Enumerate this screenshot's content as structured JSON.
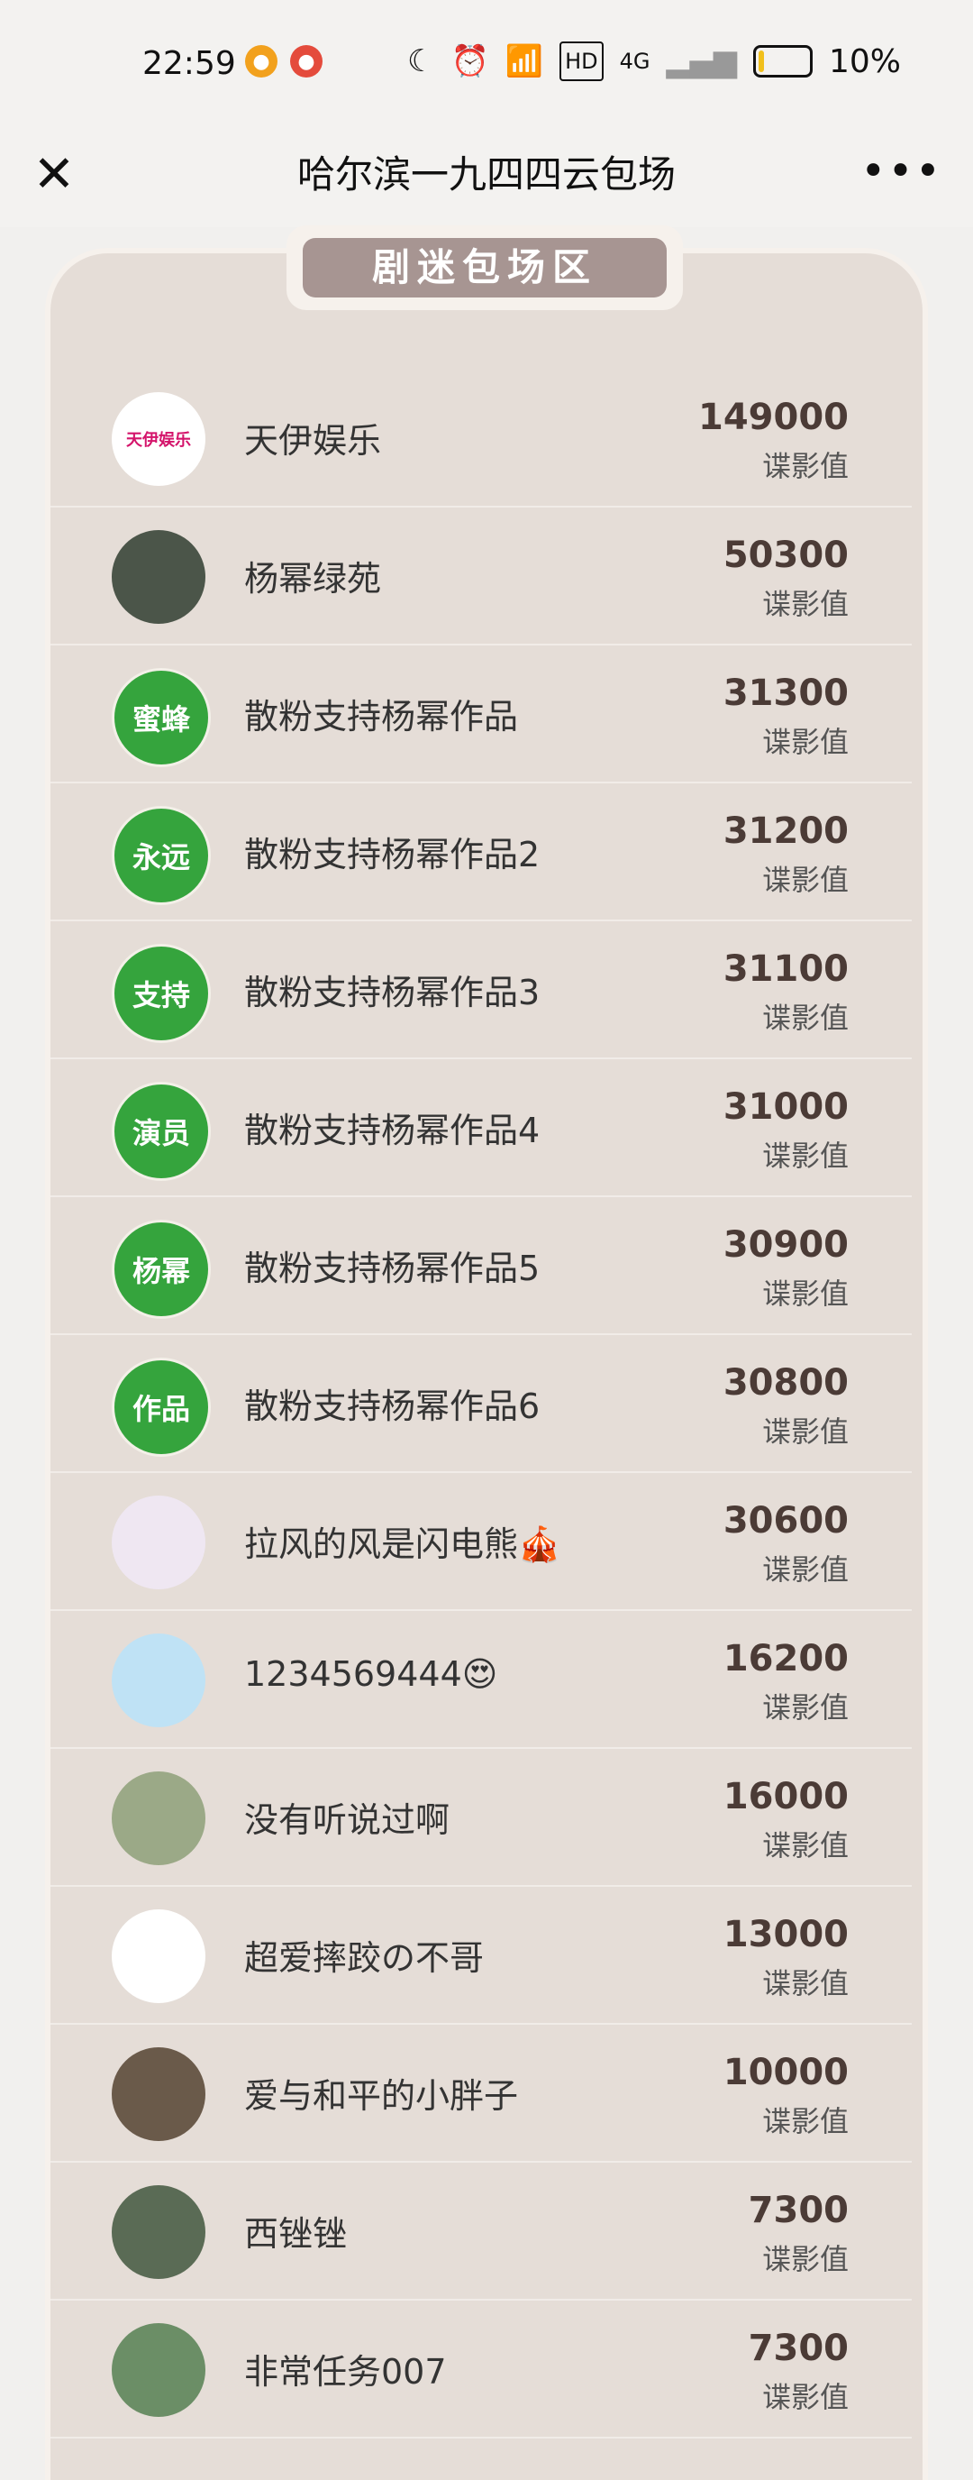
{
  "status": {
    "time": "22:59",
    "battery": "10%",
    "network": "4G",
    "hd": "HD"
  },
  "nav": {
    "title": "哈尔滨一九四四云包场",
    "close_label": "✕",
    "more_label": "•••"
  },
  "section_badge": "剧迷包场区",
  "items": [
    {
      "name": "天伊娱乐",
      "value": "149000",
      "unit": "谍影值",
      "avatar_text": "天伊娱乐"
    },
    {
      "name": "杨幂绿苑",
      "value": "50300",
      "unit": "谍影值",
      "avatar_text": ""
    },
    {
      "name": "散粉支持杨幂作品",
      "value": "31300",
      "unit": "谍影值",
      "avatar_text": "蜜蜂"
    },
    {
      "name": "散粉支持杨幂作品2",
      "value": "31200",
      "unit": "谍影值",
      "avatar_text": "永远"
    },
    {
      "name": "散粉支持杨幂作品3",
      "value": "31100",
      "unit": "谍影值",
      "avatar_text": "支持"
    },
    {
      "name": "散粉支持杨幂作品4",
      "value": "31000",
      "unit": "谍影值",
      "avatar_text": "演员"
    },
    {
      "name": "散粉支持杨幂作品5",
      "value": "30900",
      "unit": "谍影值",
      "avatar_text": "杨幂"
    },
    {
      "name": "散粉支持杨幂作品6",
      "value": "30800",
      "unit": "谍影值",
      "avatar_text": "作品"
    },
    {
      "name": "拉风的风是闪电熊🎪",
      "value": "30600",
      "unit": "谍影值",
      "avatar_text": ""
    },
    {
      "name": "1234569444😍",
      "value": "16200",
      "unit": "谍影值",
      "avatar_text": ""
    },
    {
      "name": "没有听说过啊",
      "value": "16000",
      "unit": "谍影值",
      "avatar_text": ""
    },
    {
      "name": "超爱摔跤の不哥",
      "value": "13000",
      "unit": "谍影值",
      "avatar_text": ""
    },
    {
      "name": "爱与和平的小胖子",
      "value": "10000",
      "unit": "谍影值",
      "avatar_text": ""
    },
    {
      "name": "西锉锉",
      "value": "7300",
      "unit": "谍影值",
      "avatar_text": ""
    },
    {
      "name": "非常任务007",
      "value": "7300",
      "unit": "谍影值",
      "avatar_text": ""
    }
  ]
}
